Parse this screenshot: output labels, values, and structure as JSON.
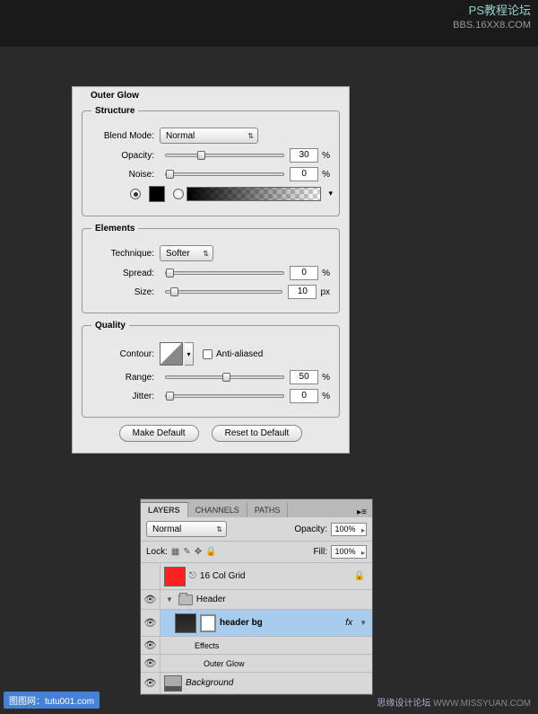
{
  "watermarks": {
    "tr_cn": "PS教程论坛",
    "tr_en": "BBS.16XX8.COM",
    "bl": "图图网：tutu001.com",
    "br_cn": "思缘设计论坛",
    "br_en": "WWW.MISSYUAN.COM"
  },
  "dialog": {
    "title": "Outer Glow",
    "structure": {
      "legend": "Structure",
      "blend_mode_label": "Blend Mode:",
      "blend_mode_value": "Normal",
      "opacity_label": "Opacity:",
      "opacity_value": "30",
      "opacity_unit": "%",
      "noise_label": "Noise:",
      "noise_value": "0",
      "noise_unit": "%"
    },
    "elements": {
      "legend": "Elements",
      "technique_label": "Technique:",
      "technique_value": "Softer",
      "spread_label": "Spread:",
      "spread_value": "0",
      "spread_unit": "%",
      "size_label": "Size:",
      "size_value": "10",
      "size_unit": "px"
    },
    "quality": {
      "legend": "Quality",
      "contour_label": "Contour:",
      "antialiased_label": "Anti-aliased",
      "range_label": "Range:",
      "range_value": "50",
      "range_unit": "%",
      "jitter_label": "Jitter:",
      "jitter_value": "0",
      "jitter_unit": "%"
    },
    "buttons": {
      "make_default": "Make Default",
      "reset_default": "Reset to Default"
    }
  },
  "layers_panel": {
    "tabs": {
      "layers": "LAYERS",
      "channels": "CHANNELS",
      "paths": "PATHS"
    },
    "blend_mode": "Normal",
    "opacity_label": "Opacity:",
    "opacity_value": "100%",
    "lock_label": "Lock:",
    "fill_label": "Fill:",
    "fill_value": "100%",
    "layers": {
      "grid": "16 Col Grid",
      "header": "Header",
      "header_bg": "header bg",
      "effects": "Effects",
      "outer_glow": "Outer Glow",
      "background": "Background"
    },
    "fx": "fx"
  }
}
